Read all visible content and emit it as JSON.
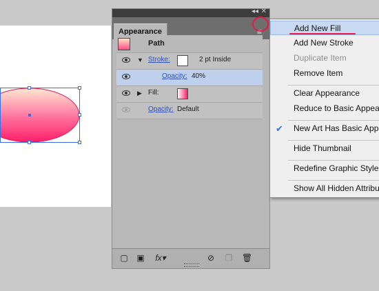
{
  "panel": {
    "title": "Appearance",
    "object_label": "Path",
    "rows": [
      {
        "label": "Stroke:",
        "value": "2 pt  Inside"
      },
      {
        "label": "Opacity:",
        "value": "40%"
      },
      {
        "label": "Fill:",
        "value": ""
      },
      {
        "label": "Opacity:",
        "value": "Default"
      }
    ],
    "bottom_tools": [
      "new-stroke-icon",
      "new-fill-icon",
      "fx-icon",
      "clear-icon",
      "duplicate-icon",
      "trash-icon"
    ]
  },
  "menu": {
    "items": [
      {
        "label": "Add New Fill",
        "state": "highlighted"
      },
      {
        "label": "Add New Stroke",
        "state": "normal"
      },
      {
        "label": "Duplicate Item",
        "state": "disabled"
      },
      {
        "label": "Remove Item",
        "state": "normal"
      },
      {
        "label": "Clear Appearance",
        "state": "normal"
      },
      {
        "label": "Reduce to Basic Appear",
        "state": "normal"
      },
      {
        "label": "New Art Has Basic Appe",
        "state": "checked"
      },
      {
        "label": "Hide Thumbnail",
        "state": "normal"
      },
      {
        "label": "Redefine Graphic Style \"",
        "state": "normal"
      },
      {
        "label": "Show All Hidden Attribu",
        "state": "normal"
      }
    ]
  },
  "colors": {
    "selection": "#3a6fe0",
    "annotation": "#e8184a",
    "gradient_top": "#ffe0c8",
    "gradient_bottom": "#ff1f6a"
  }
}
